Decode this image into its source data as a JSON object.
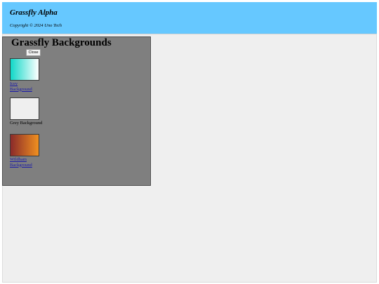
{
  "header": {
    "app_title": "Grassfly Alpha",
    "copyright": "Copyright © 2024 Uno Tech",
    "background_color": "#66c8ff"
  },
  "dialog": {
    "title": "Grassfly Backgrounds",
    "close_label": "Close",
    "items": [
      {
        "label": "Icey Background",
        "link": true,
        "swatch_colors": [
          "#10d8c8",
          "#ffffff"
        ]
      },
      {
        "label": "Grey Background",
        "link": false,
        "swatch_colors": [
          "#efefef"
        ]
      },
      {
        "label": "Wildham Background",
        "link": true,
        "swatch_colors": [
          "#8a2a2a",
          "#f09020"
        ]
      }
    ]
  }
}
